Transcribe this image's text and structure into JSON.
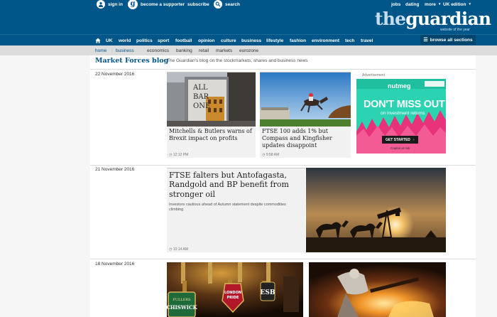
{
  "topbar": {
    "sign_in": "sign in",
    "become_supporter": "become a supporter",
    "subscribe": "subscribe",
    "search": "search",
    "jobs": "jobs",
    "dating": "dating",
    "more": "more",
    "edition": "UK edition"
  },
  "logo": {
    "the": "the",
    "guardian": "guardian",
    "tagline": "website of the year"
  },
  "nav": {
    "items": [
      "UK",
      "world",
      "politics",
      "sport",
      "football",
      "opinion",
      "culture",
      "business",
      "lifestyle",
      "fashion",
      "environment",
      "tech",
      "travel"
    ],
    "browse": "browse all sections"
  },
  "subnav": {
    "items": [
      "home",
      "business",
      "economics",
      "banking",
      "retail",
      "markets",
      "eurozone"
    ]
  },
  "blog": {
    "title": "Market Forces blog",
    "description": "The Guardian's blog on the stockmarkets, shares and business news"
  },
  "sections": [
    {
      "date": "22 November 2016",
      "cards": [
        {
          "headline": "Mitchells & Butlers warns of Brexit impact on profits",
          "time": "12:12 PM",
          "image_text": "ALL BAR ONE"
        },
        {
          "headline": "FTSE 100 adds 1% but Compass and Kingfisher updates disappoint",
          "time": "9:58 AM"
        }
      ]
    },
    {
      "date": "21 November 2016",
      "cards": [
        {
          "headline": "FTSE falters but Antofagasta, Randgold and BP benefit from stronger oil",
          "standfirst": "Investors cautious ahead of Autumn statement despite commodities climbing",
          "time": "10:14 AM"
        }
      ]
    },
    {
      "date": "18 November 2016",
      "cards": [
        {
          "image_text": [
            "FULLERS",
            "CHISWICK",
            "LONDON PRIDE",
            "ESB"
          ]
        }
      ]
    }
  ],
  "advert": {
    "label": "Advertisement",
    "brand": "nutmeg",
    "headline": "DON'T MISS OUT",
    "subline": "on investment returns",
    "cta": "GET STARTED",
    "fine_print": "Capital at risk"
  },
  "colors": {
    "brand_blue": "#005689",
    "dark_blue": "#00456e",
    "ad_teal": "#2bd3b3",
    "ad_pink": "#e8337a"
  }
}
